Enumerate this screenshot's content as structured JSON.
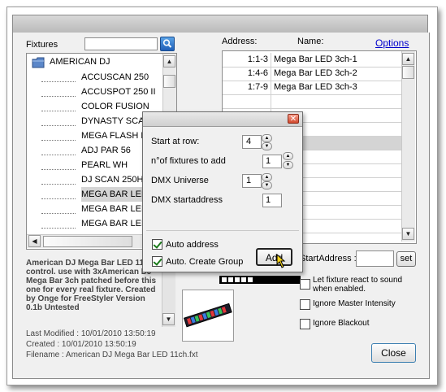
{
  "labels": {
    "fixtures": "Fixtures",
    "address_col": "Address:",
    "name_col": "Name:",
    "options_link": "Options",
    "start_address": "StartAddress :",
    "set_button": "set",
    "close_button": "Close"
  },
  "tree": {
    "root": "AMERICAN DJ",
    "items": [
      "ACCUSCAN 250",
      "ACCUSPOT 250 II",
      "COLOR FUSION",
      "DYNASTY SCAN",
      "MEGA FLASH DM",
      "ADJ PAR 56",
      "PEARL WH",
      "DJ SCAN 250HP",
      "MEGA BAR LED 1",
      "MEGA BAR LED 3",
      "MEGA BAR LED 4"
    ],
    "selected_index": 8
  },
  "patch_list": [
    {
      "address": "1:1-3",
      "name": "Mega Bar LED 3ch-1"
    },
    {
      "address": "1:4-6",
      "name": "Mega Bar LED 3ch-2"
    },
    {
      "address": "1:7-9",
      "name": "Mega Bar LED 3ch-3"
    }
  ],
  "description": "American DJ Mega Bar LED 11ch control. use with 3xAmerican DJ Mega Bar 3ch patched before this one for every real fixture. Created by Onge for FreeStyler Version 0.1b Untested",
  "meta": {
    "last_modified": "Last Modified : 10/01/2010 13:50:19",
    "created": "Created :  10/01/2010 13:50:19",
    "filename": "Filename : American DJ Mega Bar LED 11ch.fxt"
  },
  "options": [
    {
      "label": "Let fixture react to sound when enabled.",
      "checked": false
    },
    {
      "label": "Ignore Master Intensity",
      "checked": false
    },
    {
      "label": "Ignore Blackout",
      "checked": false
    }
  ],
  "dialog": {
    "start_row_label": "Start at row:",
    "start_row_value": "4",
    "fixtures_to_add_label": "n°of fixtures to add",
    "fixtures_to_add_value": "1",
    "dmx_universe_label": "DMX Universe",
    "dmx_universe_value": "1",
    "dmx_startaddress_label": "DMX startaddress",
    "dmx_startaddress_value": "1",
    "auto_address_label": "Auto address",
    "auto_address_checked": true,
    "auto_group_label": "Auto. Create Group",
    "auto_group_checked": true,
    "add_button": "Add"
  },
  "colors": {
    "window_bg": "#f0f0f0",
    "link": "#0000cc",
    "selection": "#d4d4d4"
  }
}
